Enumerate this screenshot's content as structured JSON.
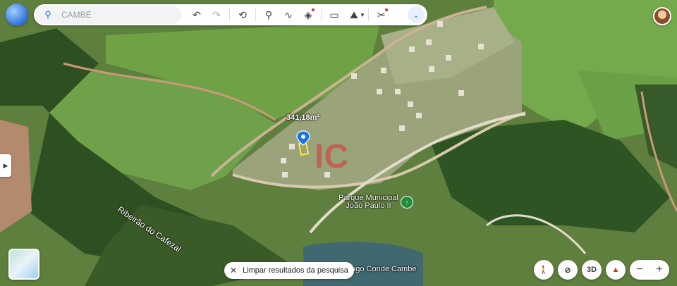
{
  "search": {
    "value": "",
    "placeholder": "CAMBÉ"
  },
  "toolbar": {
    "undo": "↶",
    "redo": "↷",
    "history": "⟲",
    "place": "⚲",
    "path": "∿",
    "layers": "◈",
    "measure": "▭",
    "photo": "⛰",
    "tools": "✂",
    "expand": "⌄"
  },
  "map": {
    "area_label": "341,18m²",
    "river_label": "Ribeirão do Cafezal",
    "park_label_line1": "Parque Municipal",
    "park_label_line2": "João Paulo II",
    "lake_label": "Lago Conde Cambe",
    "watermark": "IC"
  },
  "clear_results": "Limpar resultados da pesquisa",
  "controls": {
    "streetview": "🚶",
    "recenter": "⊘",
    "view3d": "3D",
    "compass": "▲",
    "zoom_out": "−",
    "zoom_in": "+"
  },
  "colors": {
    "accent": "#1a73e8",
    "alert_dot": "#d93025",
    "park_green": "#1e8e3e"
  }
}
